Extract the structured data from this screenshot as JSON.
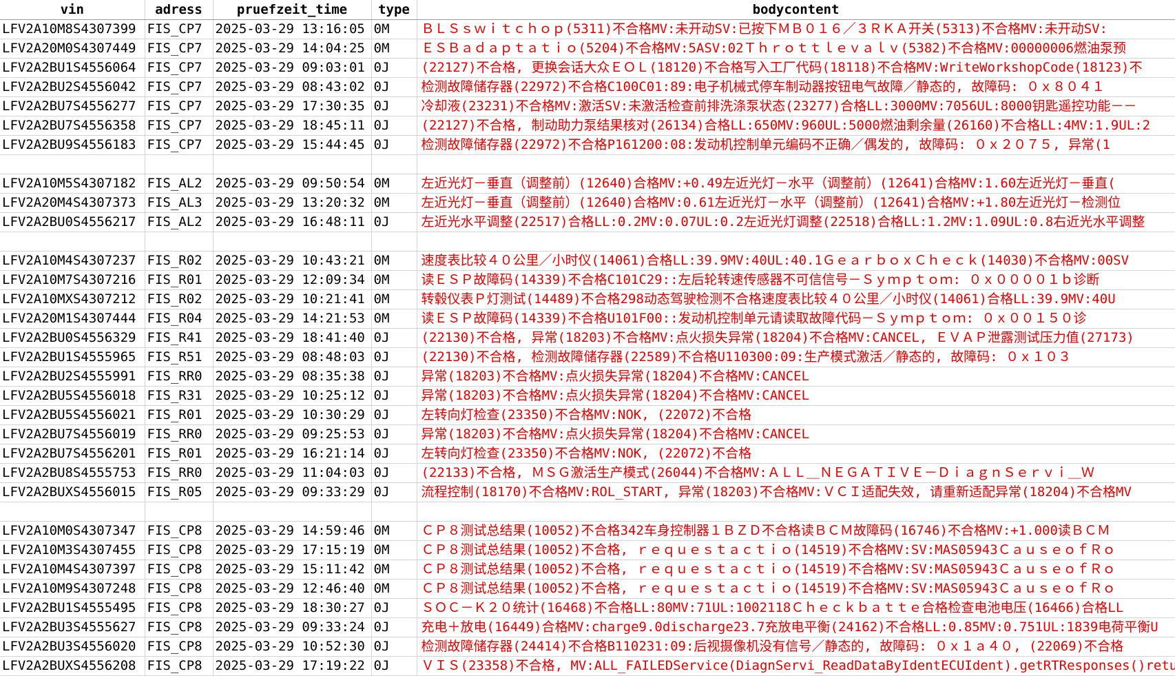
{
  "columns": [
    "vin",
    "adress",
    "pruefzeit_time",
    "type",
    "bodycontent"
  ],
  "rows": [
    {
      "vin": "LFV2A10M8S4307399",
      "adress": "FIS_CP7",
      "time": "2025-03-29 13:16:05",
      "type": "0M",
      "body": "ＢＬＳｓｗｉｔｃｈｏｐ(5311)不合格MV:未开动SV:已按下ＭＢ０１６／３ＲＫＡ开关(5313)不合格MV:未开动SV:"
    },
    {
      "vin": "LFV2A20M0S4307449",
      "adress": "FIS_CP7",
      "time": "2025-03-29 14:04:25",
      "type": "0M",
      "body": "ＥＳＢａｄａｐｔａｔｉｏ(5204)不合格MV:5ASV:02Ｔｈｒｏｔｔｌｅｖａｌｖ(5382)不合格MV:00000006燃油泵预"
    },
    {
      "vin": "LFV2A2BU1S4556064",
      "adress": "FIS_CP7",
      "time": "2025-03-29 09:03:01",
      "type": "0J",
      "body": "(22127)不合格, 更换会话大众ＥＯＬ(18120)不合格写入工厂代码(18118)不合格MV:WriteWorkshopCode(18123)不"
    },
    {
      "vin": "LFV2A2BU2S4556042",
      "adress": "FIS_CP7",
      "time": "2025-03-29 08:43:02",
      "type": "0J",
      "body": "检测故障储存器(22972)不合格C100C01:89:电子机械式停车制动器按钮电气故障／静态的, 故障码: ０ｘ８０４１"
    },
    {
      "vin": "LFV2A2BU7S4556277",
      "adress": "FIS_CP7",
      "time": "2025-03-29 17:30:35",
      "type": "0J",
      "body": "冷却液(23231)不合格MV:激活SV:未激活检查前排洗涤泵状态(23277)合格LL:3000MV:7056UL:8000钥匙遥控功能－－"
    },
    {
      "vin": "LFV2A2BU7S4556358",
      "adress": "FIS_CP7",
      "time": "2025-03-29 18:45:11",
      "type": "0J",
      "body": "(22127)不合格, 制动助力泵结果核对(26134)合格LL:650MV:960UL:5000燃油剩余量(26160)不合格LL:4MV:1.9UL:2"
    },
    {
      "vin": "LFV2A2BU9S4556183",
      "adress": "FIS_CP7",
      "time": "2025-03-29 15:44:45",
      "type": "0J",
      "body": "检测故障储存器(22972)不合格P161200:08:发动机控制单元编码不正确／偶发的, 故障码: ０ｘ２０７５, 异常(1"
    },
    {
      "blank": true
    },
    {
      "vin": "LFV2A10M5S4307182",
      "adress": "FIS_AL2",
      "time": "2025-03-29 09:50:54",
      "type": "0M",
      "body": "左近光灯－垂直（调整前）(12640)合格MV:+0.49左近光灯－水平（调整前）(12641)合格MV:1.60左近光灯－垂直("
    },
    {
      "vin": "LFV2A20M4S4307373",
      "adress": "FIS_AL3",
      "time": "2025-03-29 13:20:32",
      "type": "0M",
      "body": "左近光灯－垂直（调整前）(12640)合格MV:0.61左近光灯－水平（调整前）(12641)合格MV:+1.80左近光灯－检测位"
    },
    {
      "vin": "LFV2A2BU0S4556217",
      "adress": "FIS_AL2",
      "time": "2025-03-29 16:48:11",
      "type": "0J",
      "body": "左近光水平调整(22517)合格LL:0.2MV:0.07UL:0.2左近光灯调整(22518)合格LL:1.2MV:1.09UL:0.8右近光水平调整"
    },
    {
      "blank": true
    },
    {
      "vin": "LFV2A10M4S4307237",
      "adress": "FIS_R02",
      "time": "2025-03-29 10:43:21",
      "type": "0M",
      "body": "速度表比较４０公里／小时仪(14061)合格LL:39.9MV:40UL:40.1ＧｅａｒｂｏｘＣｈｅｃｋ(14030)不合格MV:00SV"
    },
    {
      "vin": "LFV2A10M7S4307216",
      "adress": "FIS_R01",
      "time": "2025-03-29 12:09:34",
      "type": "0M",
      "body": "读ＥＳＰ故障码(14339)不合格C101C29::左后轮转速传感器不可信信号－Ｓｙｍｐｔｏｍ: ０ｘ００００１ｂ诊断"
    },
    {
      "vin": "LFV2A10MXS4307212",
      "adress": "FIS_R02",
      "time": "2025-03-29 10:21:41",
      "type": "0M",
      "body": "转毂仪表Ｐ灯测试(14489)不合格298动态驾驶检测不合格速度表比较４０公里／小时仪(14061)合格LL:39.9MV:40U"
    },
    {
      "vin": "LFV2A20M1S4307444",
      "adress": "FIS_R04",
      "time": "2025-03-29 14:21:53",
      "type": "0M",
      "body": "读ＥＳＰ故障码(14339)不合格U101F00::发动机控制单元请读取故障代码－Ｓｙｍｐｔｏｍ: ０ｘ００１５０诊"
    },
    {
      "vin": "LFV2A2BU0S4556329",
      "adress": "FIS_R41",
      "time": "2025-03-29 18:41:40",
      "type": "0J",
      "body": "(22130)不合格, 异常(18203)不合格MV:点火损失异常(18204)不合格MV:CANCEL, ＥＶＡＰ泄露测试压力值(27173)"
    },
    {
      "vin": "LFV2A2BU1S4555965",
      "adress": "FIS_R51",
      "time": "2025-03-29 08:48:03",
      "type": "0J",
      "body": "(22130)不合格, 检测故障储存器(22589)不合格U110300:09:生产模式激活／静态的, 故障码: ０ｘ１０３"
    },
    {
      "vin": "LFV2A2BU2S4555991",
      "adress": "FIS_RR0",
      "time": "2025-03-29 08:35:38",
      "type": "0J",
      "body": "异常(18203)不合格MV:点火损失异常(18204)不合格MV:CANCEL"
    },
    {
      "vin": "LFV2A2BU5S4556018",
      "adress": "FIS_R31",
      "time": "2025-03-29 10:25:12",
      "type": "0J",
      "body": "异常(18203)不合格MV:点火损失异常(18204)不合格MV:CANCEL"
    },
    {
      "vin": "LFV2A2BU5S4556021",
      "adress": "FIS_R01",
      "time": "2025-03-29 10:30:29",
      "type": "0J",
      "body": "左转向灯检查(23350)不合格MV:NOK, (22072)不合格"
    },
    {
      "vin": "LFV2A2BU7S4556019",
      "adress": "FIS_RR0",
      "time": "2025-03-29 09:25:53",
      "type": "0J",
      "body": "异常(18203)不合格MV:点火损失异常(18204)不合格MV:CANCEL"
    },
    {
      "vin": "LFV2A2BU7S4556201",
      "adress": "FIS_R01",
      "time": "2025-03-29 16:21:14",
      "type": "0J",
      "body": "左转向灯检查(23350)不合格MV:NOK, (22072)不合格"
    },
    {
      "vin": "LFV2A2BU8S4555753",
      "adress": "FIS_RR0",
      "time": "2025-03-29 11:04:03",
      "type": "0J",
      "body": "(22133)不合格, ＭＳＧ激活生产模式(26044)不合格MV:ＡＬＬ＿ＮＥＧＡＴＩＶＥ－ＤｉａｇｎＳｅｒｖｉ＿Ｗ"
    },
    {
      "vin": "LFV2A2BUXS4556015",
      "adress": "FIS_R05",
      "time": "2025-03-29 09:33:29",
      "type": "0J",
      "body": "流程控制(18170)不合格MV:ROL_START, 异常(18203)不合格MV:ＶＣＩ适配失效, 请重新适配异常(18204)不合格MV"
    },
    {
      "blank": true
    },
    {
      "vin": "LFV2A10M0S4307347",
      "adress": "FIS_CP8",
      "time": "2025-03-29 14:59:46",
      "type": "0M",
      "body": "ＣＰ８测试总结果(10052)不合格342车身控制器１ＢＺＤ不合格读ＢＣＭ故障码(16746)不合格MV:+1.000读ＢＣＭ"
    },
    {
      "vin": "LFV2A10M3S4307455",
      "adress": "FIS_CP8",
      "time": "2025-03-29 17:15:19",
      "type": "0M",
      "body": "ＣＰ８测试总结果(10052)不合格, ｒｅｑｕｅｓｔａｃｔｉｏ(14519)不合格MV:SV:MAS05943ＣａｕｓｅｏｆＲｏ"
    },
    {
      "vin": "LFV2A10M4S4307397",
      "adress": "FIS_CP8",
      "time": "2025-03-29 15:11:42",
      "type": "0M",
      "body": "ＣＰ８测试总结果(10052)不合格, ｒｅｑｕｅｓｔａｃｔｉｏ(14519)不合格MV:SV:MAS05943ＣａｕｓｅｏｆＲｏ"
    },
    {
      "vin": "LFV2A10M9S4307248",
      "adress": "FIS_CP8",
      "time": "2025-03-29 12:46:40",
      "type": "0M",
      "body": "ＣＰ８测试总结果(10052)不合格, ｒｅｑｕｅｓｔａｃｔｉｏ(14519)不合格MV:SV:MAS05943ＣａｕｓｅｏｆＲｏ"
    },
    {
      "vin": "LFV2A2BU1S4555495",
      "adress": "FIS_CP8",
      "time": "2025-03-29 18:30:27",
      "type": "0J",
      "body": "ＳＯＣ－Ｋ２０统计(16468)不合格LL:80MV:71UL:1002118Ｃｈｅｃｋｂａｔｔｅ合格检查电池电压(16466)合格LL"
    },
    {
      "vin": "LFV2A2BU3S4555627",
      "adress": "FIS_CP8",
      "time": "2025-03-29 09:33:24",
      "type": "0J",
      "body": "充电＋放电(16449)合格MV:charge9.0discharge23.7充放电平衡(24162)不合格LL:0.85MV:0.751UL:1839电荷平衡U"
    },
    {
      "vin": "LFV2A2BU3S4556020",
      "adress": "FIS_CP8",
      "time": "2025-03-29 10:52:30",
      "type": "0J",
      "body": "检测故障储存器(24414)不合格B110231:09:后视摄像机没有信号／静态的, 故障码: ０ｘ１ａ４０, (22069)不合格"
    },
    {
      "vin": "LFV2A2BUXS4556208",
      "adress": "FIS_CP8",
      "time": "2025-03-29 17:19:22",
      "type": "0J",
      "body": "ＶＩＳ(23358)不合格, MV:ALL_FAILEDService(DiagnServi_ReadDataByIdentECUIdent).getRTResponses()return"
    }
  ]
}
